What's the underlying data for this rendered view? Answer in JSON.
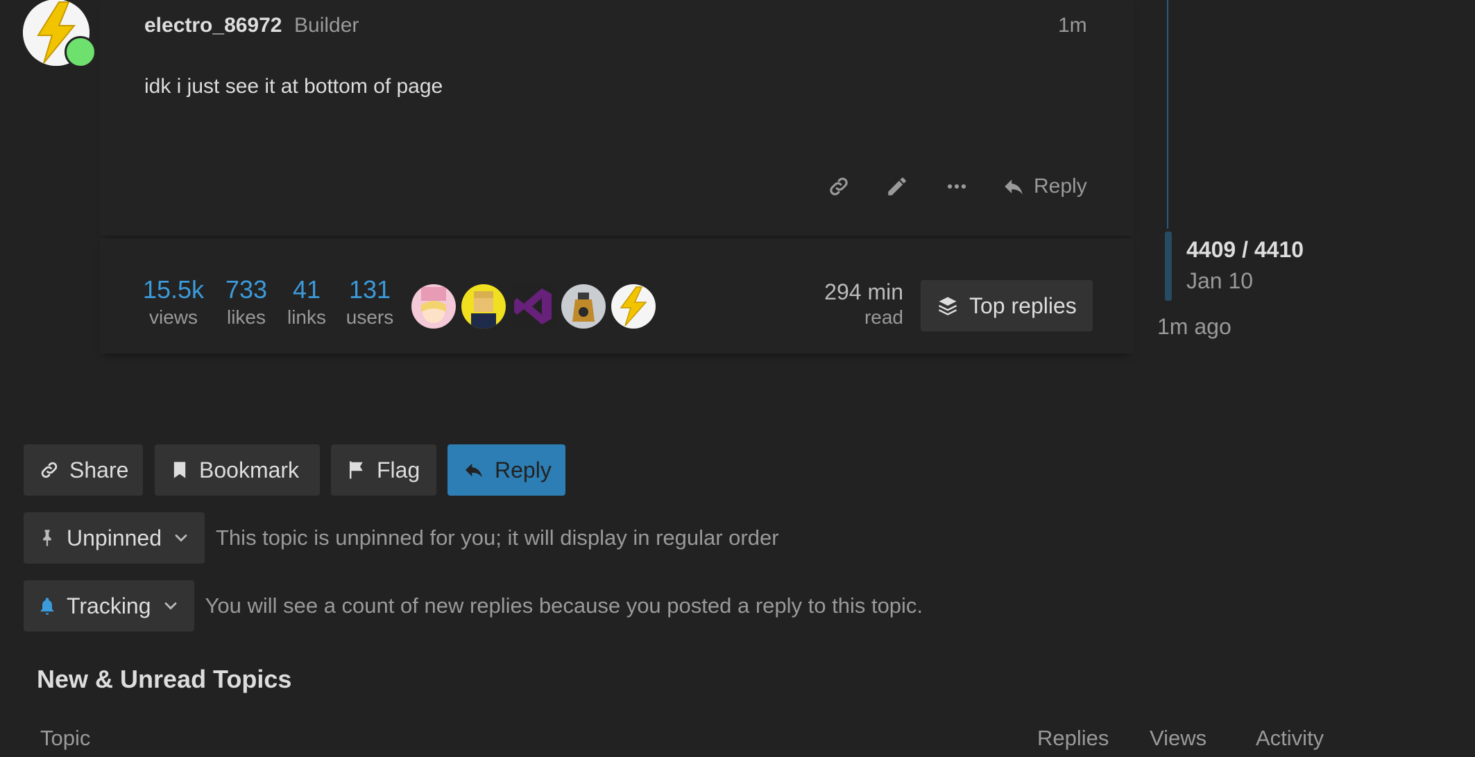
{
  "post": {
    "username": "electro_86972",
    "user_title": "Builder",
    "time": "1m",
    "body": "idk i just see it at bottom of page",
    "actions": {
      "reply_label": "Reply",
      "link_icon": "link-icon",
      "edit_icon": "pencil-icon",
      "more_icon": "ellipsis-icon",
      "reply_icon": "reply-arrow-icon"
    }
  },
  "topic_map": {
    "stats": [
      {
        "value": "15.5k",
        "label": "views"
      },
      {
        "value": "733",
        "label": "likes"
      },
      {
        "value": "41",
        "label": "links"
      },
      {
        "value": "131",
        "label": "users"
      }
    ],
    "read_time": {
      "value": "294 min",
      "label": "read"
    },
    "top_replies_label": "Top replies"
  },
  "timeline": {
    "count": "4409 / 4410",
    "date": "Jan 10",
    "ago": "1m ago"
  },
  "footer": {
    "share_label": "Share",
    "bookmark_label": "Bookmark",
    "flag_label": "Flag",
    "reply_label": "Reply"
  },
  "notifications": {
    "pin": {
      "label": "Unpinned",
      "text": "This topic is unpinned for you; it will display in regular order"
    },
    "tracking": {
      "label": "Tracking",
      "text": "You will see a count of new replies because you posted a reply to this topic."
    }
  },
  "suggested": {
    "title": "New & Unread Topics",
    "columns": [
      "Topic",
      "Replies",
      "Views",
      "Activity"
    ]
  },
  "colors": {
    "background": "#222222",
    "accent": "#3b9bdb",
    "primary_button": "#2d7eb4",
    "online": "#6ee06e"
  }
}
